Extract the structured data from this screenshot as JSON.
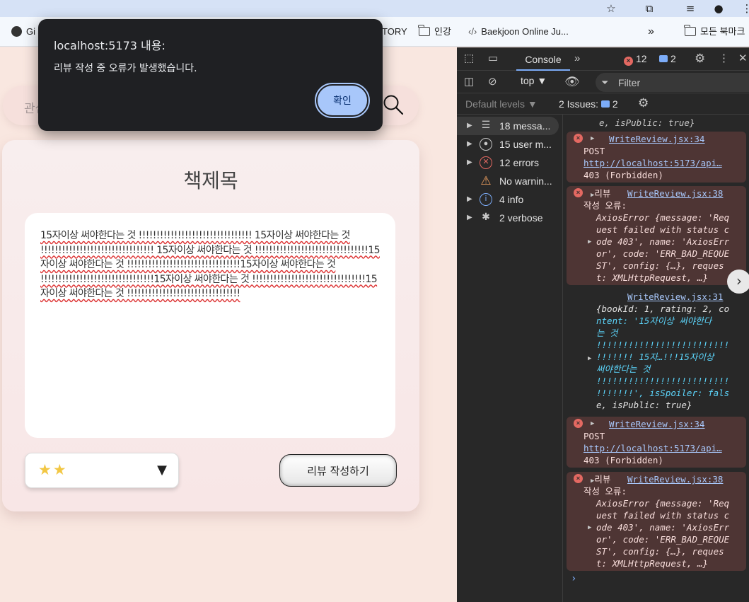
{
  "bookmarks": {
    "items": [
      {
        "label": "Gi"
      },
      {
        "label": "TORY"
      },
      {
        "label": "인강"
      },
      {
        "label": "Baekjoon Online Ju..."
      }
    ],
    "more": "»",
    "all_bookmarks": "모든 북마크"
  },
  "page": {
    "search_placeholder": "관심",
    "book_title": "책제목",
    "review_text": "15자이상 써야한다는 것 !!!!!!!!!!!!!!!!!!!!!!!!!!!!!!!! 15자이상 써야한다는 것 !!!!!!!!!!!!!!!!!!!!!!!!!!!!!!!! 15자이상 써야한다는 것 !!!!!!!!!!!!!!!!!!!!!!!!!!!!!!!!15자이상 써야한다는 것 !!!!!!!!!!!!!!!!!!!!!!!!!!!!!!!!15자이상 써야한다는 것 !!!!!!!!!!!!!!!!!!!!!!!!!!!!!!!!15자이상 써야한다는 것 !!!!!!!!!!!!!!!!!!!!!!!!!!!!!!!!15자이상 써야한다는 것 !!!!!!!!!!!!!!!!!!!!!!!!!!!!!!!!",
    "rating_stars": "★★",
    "rating_value": 2,
    "rating_arrow": "▼",
    "submit_label": "리뷰 작성하기"
  },
  "dialog": {
    "title": "localhost:5173 내용:",
    "message": "리뷰 작성 중 오류가 발생했습니다.",
    "ok_label": "확인"
  },
  "devtools": {
    "console_tab": "Console",
    "error_count": "12",
    "message_count": "2",
    "context": "top ▼",
    "filter_placeholder": "Filter",
    "levels": "Default levels ▼",
    "issues_label": "2 Issues:",
    "issues_count": "2",
    "sidebar": [
      {
        "label": "18 messa...",
        "icon": "list-icon"
      },
      {
        "label": "15 user m...",
        "icon": "user-icon"
      },
      {
        "label": "12 errors",
        "icon": "error-icon"
      },
      {
        "label": "No warnin...",
        "icon": "warning-icon"
      },
      {
        "label": "4 info",
        "icon": "info-icon"
      },
      {
        "label": "2 verbose",
        "icon": "bug-icon"
      }
    ],
    "log": {
      "top_fragment": "e, isPublic: true}",
      "e1_src": "WriteReview.jsx:34",
      "e1_method": "POST",
      "e1_url": "http://localhost:5173/api…",
      "e1_status": "403 (Forbidden)",
      "e2_prefix": "리뷰",
      "e2_src": "WriteReview.jsx:38",
      "e2_label": "작성 오류:",
      "e2_lines": [
        "AxiosError {message: 'Req",
        "uest failed with status c",
        "ode 403', name: 'AxiosErr",
        "or', code: 'ERR_BAD_REQUE",
        "ST', config: {…}, reques",
        "t: XMLHttpRequest, …}"
      ],
      "i1_src": "WriteReview.jsx:31",
      "i1_lines": [
        "{bookId: 1, rating: 2, co",
        "ntent: '15자이상 써야한다",
        "는 것",
        "!!!!!!!!!!!!!!!!!!!!!!!!!",
        "!!!!!!! 15자…!!!15자이상",
        "써야한다는 것",
        "!!!!!!!!!!!!!!!!!!!!!!!!!",
        "!!!!!!!', isSpoiler: fals",
        "e, isPublic: true}"
      ],
      "e3_src": "WriteReview.jsx:34",
      "e3_method": "POST",
      "e3_url": "http://localhost:5173/api…",
      "e3_status": "403 (Forbidden)",
      "e4_prefix": "리뷰",
      "e4_src": "WriteReview.jsx:38",
      "e4_label": "작성 오류:",
      "e4_lines": [
        "AxiosError {message: 'Req",
        "uest failed with status c",
        "ode 403', name: 'AxiosErr",
        "or', code: 'ERR_BAD_REQUE",
        "ST', config: {…}, reques",
        "t: XMLHttpRequest, …}"
      ],
      "prompt": "›"
    }
  },
  "colors": {
    "page_bg": "#f9e7e0",
    "dialog_bg": "#1f2023",
    "dialog_button": "#a8c7fa",
    "devtools_bg": "#282828",
    "error_row_bg": "#4e3534",
    "star": "#f2c744"
  }
}
